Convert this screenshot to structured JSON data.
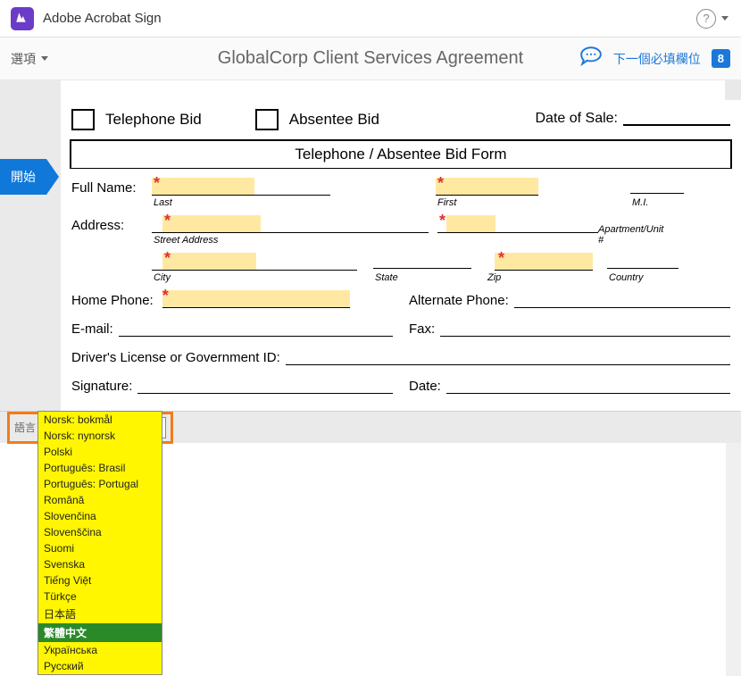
{
  "app": {
    "title": "Adobe Acrobat Sign"
  },
  "toolbar": {
    "options_label": "選項",
    "doc_title": "GlobalCorp Client Services Agreement",
    "next_field_label": "下一個必填欄位",
    "required_count": "8"
  },
  "sidebar": {
    "start_label": "開始"
  },
  "form": {
    "bid_telephone": "Telephone Bid",
    "bid_absentee": "Absentee Bid",
    "date_of_sale_label": "Date of Sale:",
    "section_title": "Telephone / Absentee Bid Form",
    "labels": {
      "full_name": "Full Name:",
      "address": "Address:",
      "home_phone": "Home Phone:",
      "alt_phone": "Alternate Phone:",
      "email": "E-mail:",
      "fax": "Fax:",
      "gov_id": "Driver's License or Government ID:",
      "signature": "Signature:",
      "date": "Date:"
    },
    "captions": {
      "last": "Last",
      "first": "First",
      "mi": "M.I.",
      "street": "Street Address",
      "apt": "Apartment/Unit #",
      "city": "City",
      "state": "State",
      "zip": "Zip",
      "country": "Country"
    }
  },
  "language": {
    "label": "語言",
    "current": "繁體中文",
    "options": [
      "Norsk: bokmål",
      "Norsk: nynorsk",
      "Polski",
      "Português: Brasil",
      "Português: Portugal",
      "Română",
      "Slovenčina",
      "Slovenščina",
      "Suomi",
      "Svenska",
      "Tiếng Việt",
      "Türkçe",
      "日本語",
      "繁體中文",
      "Українська",
      "Русский"
    ]
  }
}
